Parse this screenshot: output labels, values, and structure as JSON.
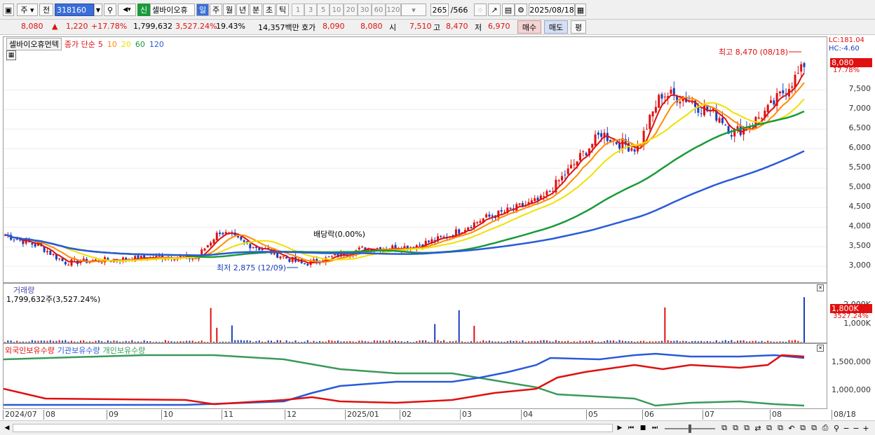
{
  "toolbar": {
    "market": "주",
    "prev": "전",
    "code": "318160",
    "new_badge": "신",
    "stock_name": "셀바이오휴",
    "periods": [
      "일",
      "주",
      "월",
      "년",
      "분",
      "초",
      "틱"
    ],
    "active_period": "일",
    "intervals": [
      "1",
      "3",
      "5",
      "10",
      "20",
      "30",
      "60",
      "120"
    ],
    "count": "265",
    "total": "/566",
    "date": "2025/08/18"
  },
  "quote": {
    "price": "8,080",
    "arrow": "▲",
    "change": "1,220",
    "rate": "+17.78%",
    "volume": "1,799,632",
    "vol_rate": "3,527.24%",
    "turnover": "19.43%",
    "amount": "14,357백만",
    "hoga_label": "호가",
    "ask": "8,090",
    "bid": "8,080",
    "open_label": "시",
    "open": "7,510",
    "high_label": "고",
    "high": "8,470",
    "low_label": "저",
    "low": "6,970",
    "buy": "매수",
    "sell": "매도",
    "extra": "평"
  },
  "price_panel": {
    "name": "셀바이오휴먼텍",
    "ma_label": "종가 단순",
    "ma": [
      {
        "p": "5",
        "c": "#e01010"
      },
      {
        "p": "10",
        "c": "#ff8c00"
      },
      {
        "p": "20",
        "c": "#f0e000"
      },
      {
        "p": "60",
        "c": "#1a9a3a"
      },
      {
        "p": "120",
        "c": "#2a5ad8"
      }
    ],
    "high_note": "최고 8,470 (08/18)",
    "low_note": "최저 2,875 (12/09)",
    "div_note": "배당락(0.00%)",
    "lc": "LC:181.04",
    "hc": "HC:-4.60",
    "cur_price": "8,080",
    "cur_rate": "17.78%",
    "yticks": [
      {
        "l": "7,500",
        "v": 7500
      },
      {
        "l": "7,000",
        "v": 7000
      },
      {
        "l": "6,500",
        "v": 6500
      },
      {
        "l": "6,000",
        "v": 6000
      },
      {
        "l": "5,500",
        "v": 5500
      },
      {
        "l": "5,000",
        "v": 5000
      },
      {
        "l": "4,500",
        "v": 4500
      },
      {
        "l": "4,000",
        "v": 4000
      },
      {
        "l": "3,500",
        "v": 3500
      },
      {
        "l": "3,000",
        "v": 3000
      }
    ]
  },
  "volume_panel": {
    "title": "거래량",
    "value": "1,799,632주(3,527.24%)",
    "yticks": [
      "2,000K",
      "1,000K"
    ],
    "cur": "1,800K",
    "cur_rate": "3527.24%"
  },
  "holdings_panel": {
    "legend": [
      "외국인보유수량",
      "기관보유수량",
      "개인보유수량"
    ],
    "yticks": [
      "1,500,000",
      "1,000,000"
    ]
  },
  "xaxis": [
    {
      "l": "2024/07",
      "x": 4
    },
    {
      "l": "08",
      "x": 62
    },
    {
      "l": "09",
      "x": 152
    },
    {
      "l": "10",
      "x": 230
    },
    {
      "l": "11",
      "x": 316
    },
    {
      "l": "12",
      "x": 406
    },
    {
      "l": "2025/01",
      "x": 492
    },
    {
      "l": "02",
      "x": 570
    },
    {
      "l": "03",
      "x": 656
    },
    {
      "l": "04",
      "x": 743
    },
    {
      "l": "05",
      "x": 836
    },
    {
      "l": "06",
      "x": 916
    },
    {
      "l": "07",
      "x": 1002
    },
    {
      "l": "08",
      "x": 1098
    },
    {
      "l": "08/18",
      "x": 1186
    }
  ],
  "colors": {
    "up": "#e01010",
    "down": "#1a3fbf",
    "ma5": "#e01010",
    "ma10": "#ff8c00",
    "ma20": "#f0e000",
    "ma60": "#1a9a3a",
    "ma120": "#2a5ad8",
    "foreign": "#2a5ad8",
    "inst": "#e01010",
    "indiv": "#3a9a5a"
  }
}
